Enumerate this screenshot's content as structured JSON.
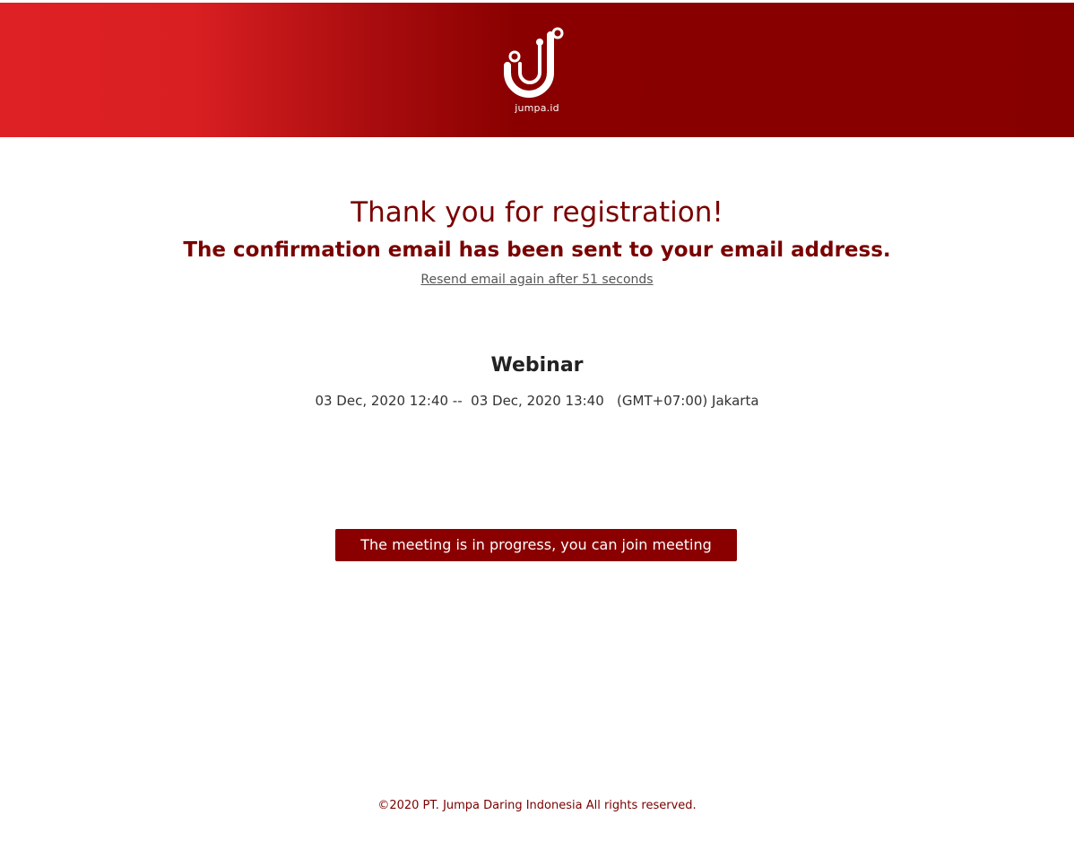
{
  "header": {
    "brand_name": "jumpa.id",
    "logo_icon": "jumpa-j-logo-icon",
    "gradient_colors": [
      "#de2124",
      "#870000"
    ]
  },
  "confirmation": {
    "headline": "Thank you for registration!",
    "subline": "The confirmation email has been sent to your email address.",
    "resend_link": "Resend email again after 51 seconds"
  },
  "event": {
    "title": "Webinar",
    "time_range": "03 Dec, 2020 12:40 --  03 Dec, 2020 13:40   (GMT+07:00) Jakarta"
  },
  "join_button": {
    "label": "The meeting is in progress, you can join meeting",
    "color": "#8a0000"
  },
  "footer": {
    "copyright": "©2020 PT. Jumpa Daring Indonesia All rights reserved."
  },
  "colors": {
    "accent": "#7a0000",
    "link": "#555555"
  }
}
